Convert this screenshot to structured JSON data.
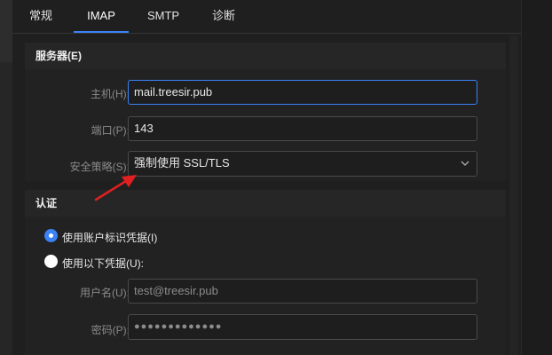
{
  "tabs": [
    {
      "label": "常规",
      "active": false
    },
    {
      "label": "IMAP",
      "active": true
    },
    {
      "label": "SMTP",
      "active": false
    },
    {
      "label": "诊断",
      "active": false
    }
  ],
  "server_section": {
    "title": "服务器(E)",
    "host": {
      "label": "主机(H):",
      "value": "mail.treesir.pub"
    },
    "port": {
      "label": "端口(P):",
      "value": "143"
    },
    "security": {
      "label": "安全策略(S):",
      "value": "强制使用 SSL/TLS"
    }
  },
  "auth_section": {
    "title": "认证",
    "option_account": {
      "label": "使用账户标识凭据(I)",
      "checked": true
    },
    "option_custom": {
      "label": "使用以下凭据(U):",
      "checked": false
    },
    "username": {
      "label": "用户名(U):",
      "value": "test@treesir.pub"
    },
    "password": {
      "label": "密码(P):",
      "value": "●●●●●●●●●●●●●"
    }
  },
  "colors": {
    "accent": "#3b82f6",
    "annotation_arrow": "#e02020"
  }
}
